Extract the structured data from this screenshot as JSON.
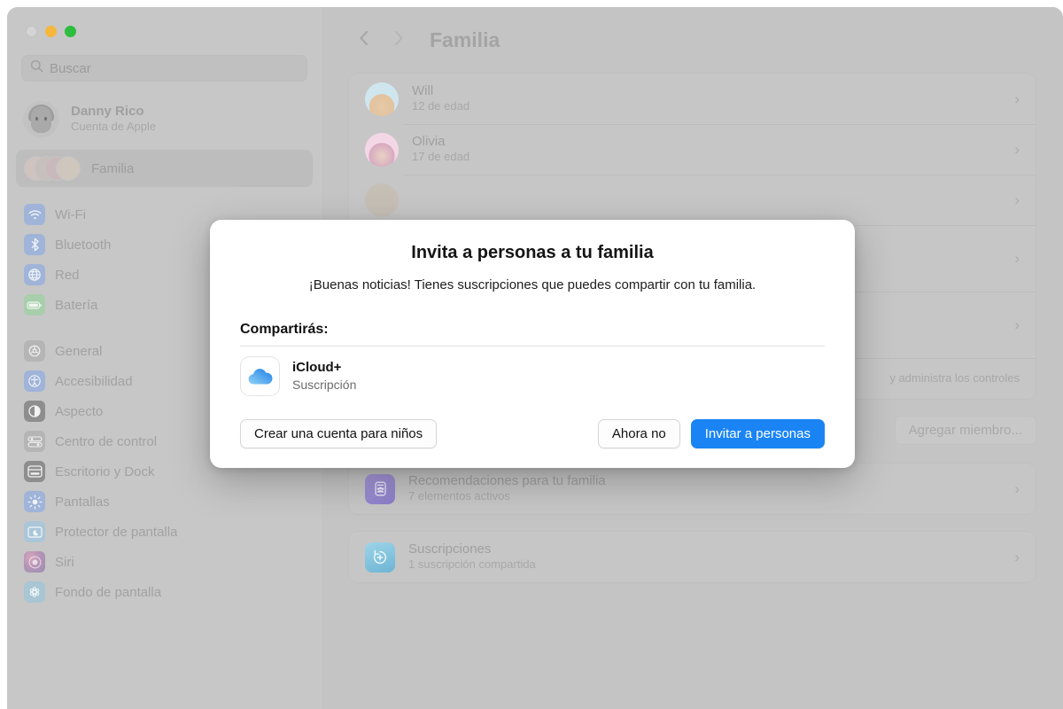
{
  "window": {
    "traffic_lights": [
      "close-button",
      "minimize-button",
      "maximize-button"
    ]
  },
  "sidebar": {
    "search": {
      "placeholder": "Buscar",
      "value": "",
      "icon": "search-icon"
    },
    "account": {
      "name": "Danny Rico",
      "subtitle": "Cuenta de Apple",
      "avatar": "memoji-avatar"
    },
    "familia": {
      "label": "Familia",
      "selected": true,
      "icon": "family-avatars-icon"
    },
    "groups": [
      {
        "items": [
          {
            "label": "Wi-Fi",
            "icon": "wifi-icon",
            "color": "#9fb4d8"
          },
          {
            "label": "Bluetooth",
            "icon": "bluetooth-icon",
            "color": "#9fb4d8"
          },
          {
            "label": "Red",
            "icon": "network-icon",
            "color": "#9fb4d8"
          },
          {
            "label": "Batería",
            "icon": "battery-icon",
            "color": "#a8ceac"
          }
        ]
      },
      {
        "items": [
          {
            "label": "General",
            "icon": "gear-icon",
            "color": "#b5b5b5"
          },
          {
            "label": "Accesibilidad",
            "icon": "accessibility-icon",
            "color": "#9fb4d8"
          },
          {
            "label": "Aspecto",
            "icon": "appearance-icon",
            "color": "#8e8e8e"
          },
          {
            "label": "Centro de control",
            "icon": "control-center-icon",
            "color": "#b5b5b5"
          },
          {
            "label": "Escritorio y Dock",
            "icon": "desktop-dock-icon",
            "color": "#8e8e8e"
          },
          {
            "label": "Pantallas",
            "icon": "displays-icon",
            "color": "#9fb4d8"
          },
          {
            "label": "Protector de pantalla",
            "icon": "screensaver-icon",
            "color": "#aac6d8"
          },
          {
            "label": "Siri",
            "icon": "siri-icon",
            "color": "#b79db0"
          },
          {
            "label": "Fondo de pantalla",
            "icon": "wallpaper-icon",
            "color": "#a8c6d4"
          }
        ]
      }
    ]
  },
  "main": {
    "back_icon": "chevron-left-icon",
    "forward_icon": "chevron-right-icon",
    "title": "Familia",
    "members": [
      {
        "name": "Will",
        "detail": "12 de edad",
        "avatar": "memoji-will"
      },
      {
        "name": "Olivia",
        "detail": "17 de edad",
        "avatar": "memoji-olivia"
      }
    ],
    "obscured_rows": [
      {
        "name": "",
        "detail": ""
      },
      {
        "name": "",
        "detail": ""
      },
      {
        "name": "",
        "detail": ""
      }
    ],
    "partial_text": "y administra los controles",
    "add_member_button": "Agregar miembro...",
    "feature_rows": [
      {
        "title": "Recomendaciones para tu familia",
        "subtitle": "7 elementos activos",
        "icon": "family-recommendations-icon",
        "color": "#9a8ed0"
      },
      {
        "title": "Suscripciones",
        "subtitle": "1 suscripción compartida",
        "icon": "subscriptions-icon",
        "color": "#7fc2dd"
      }
    ]
  },
  "sheet": {
    "title": "Invita a personas a tu familia",
    "body": "¡Buenas noticias! Tienes suscripciones que puedes compartir con tu familia.",
    "share_label": "Compartirás:",
    "items": [
      {
        "name": "iCloud+",
        "subtitle": "Suscripción",
        "icon": "icloud-icon"
      }
    ],
    "buttons": {
      "create_child": "Crear una cuenta para niños",
      "not_now": "Ahora no",
      "invite": "Invitar a personas"
    },
    "accent_color": "#1a84f5"
  }
}
